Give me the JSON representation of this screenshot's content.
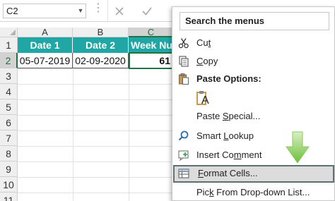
{
  "formula_bar": {
    "name_box": "C2",
    "name_box_arrow": "▼",
    "dots": "⋮",
    "cancel_icon": "x-icon",
    "enter_icon": "checkmark-icon"
  },
  "sheet": {
    "columns": [
      "A",
      "B",
      "C"
    ],
    "active_column": "C",
    "rows": [
      "1",
      "2",
      "3",
      "4",
      "5",
      "6",
      "7",
      "8",
      "9",
      "10",
      "11"
    ],
    "active_row": "2",
    "header_row": [
      "Date 1",
      "Date 2",
      "Week Nu"
    ],
    "data_row": [
      "05-07-2019",
      "02-09-2020",
      "61"
    ],
    "colors": {
      "header_fill": "#20a6a5",
      "header_text": "#ffffff",
      "selection": "#217346"
    }
  },
  "context_menu": {
    "search_placeholder": "Search the menus",
    "items": [
      {
        "label_pre": "Cu",
        "label_ul": "t",
        "label_post": "",
        "icon": "scissors-icon"
      },
      {
        "label_pre": "",
        "label_ul": "C",
        "label_post": "opy",
        "icon": "copy-icon"
      },
      {
        "label_pre": "Paste Options:",
        "label_ul": "",
        "label_post": "",
        "icon": "clipboard-icon",
        "section": true
      },
      {
        "label_pre": "Paste ",
        "label_ul": "S",
        "label_post": "pecial...",
        "icon": ""
      },
      {
        "label_pre": "Smart ",
        "label_ul": "L",
        "label_post": "ookup",
        "icon": "search-icon"
      },
      {
        "label_pre": "Insert Co",
        "label_ul": "m",
        "label_post": "ment",
        "icon": "insert-comment-icon"
      },
      {
        "label_pre": "",
        "label_ul": "F",
        "label_post": "ormat Cells...",
        "icon": "format-cells-icon",
        "highlight": true
      },
      {
        "label_pre": "Pic",
        "label_ul": "k",
        "label_post": " From Drop-down List...",
        "icon": ""
      }
    ],
    "paste_option_glyph": "A",
    "highlight_color": "#dcdcdc",
    "highlight_border": "#5f6f6f"
  },
  "arrow": {
    "color": "#7cc242",
    "direction": "down",
    "icon": "arrow-down-icon"
  }
}
